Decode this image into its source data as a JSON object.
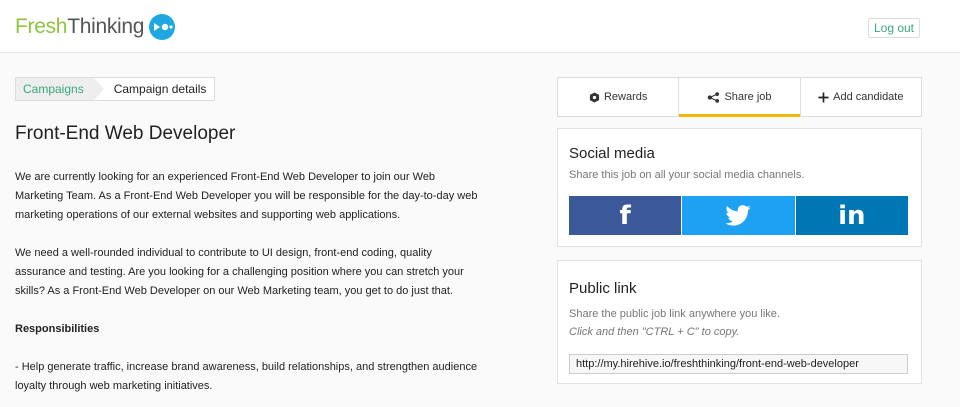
{
  "header": {
    "logo_part1": "Fresh",
    "logo_part2": "Thinking",
    "logout_label": "Log out"
  },
  "breadcrumb": {
    "items": [
      "Campaigns",
      "Campaign details"
    ]
  },
  "job": {
    "title": "Front-End Web Developer",
    "paragraphs": [
      "We are currently looking for an experienced Front-End Web Developer to join our Web Marketing Team. As a Front-End Web Developer you will be responsible for the day-to-day web marketing operations of our external websites and supporting web applications.",
      "We need a well-rounded individual to contribute to UI design, front-end coding, quality assurance and testing. Are you looking for a challenging position where you can stretch your skills? As a Front-End Web Developer on our Web Marketing team, you get to do just that."
    ],
    "responsibilities_heading": "Responsibilities",
    "responsibility_1": "- Help generate traffic, increase brand awareness, build relationships, and strengthen audience loyalty through web marketing initiatives."
  },
  "tabs": [
    {
      "label": "Rewards",
      "icon": "rewards-icon"
    },
    {
      "label": "Share job",
      "icon": "share-icon",
      "active": true
    },
    {
      "label": "Add candidate",
      "icon": "plus-icon"
    }
  ],
  "social": {
    "title": "Social media",
    "subtitle": "Share this job on all your social media channels.",
    "buttons": [
      {
        "name": "facebook",
        "glyph": "f",
        "color": "#3b5998"
      },
      {
        "name": "twitter",
        "icon": "twitter-icon",
        "color": "#1da1f2"
      },
      {
        "name": "linkedin",
        "glyph": "in",
        "color": "#0077b5"
      }
    ]
  },
  "public_link": {
    "title": "Public link",
    "subtitle": "Share the public job link anywhere you like.",
    "hint": "Click and then \"CTRL + C\" to copy.",
    "url": "http://my.hirehive.io/freshthinking/front-end-web-developer"
  },
  "colors": {
    "accent_green": "#8cc63f",
    "link_green": "#3aa87a",
    "active_tab": "#f5b800",
    "logo_blue": "#1ea7e1"
  }
}
